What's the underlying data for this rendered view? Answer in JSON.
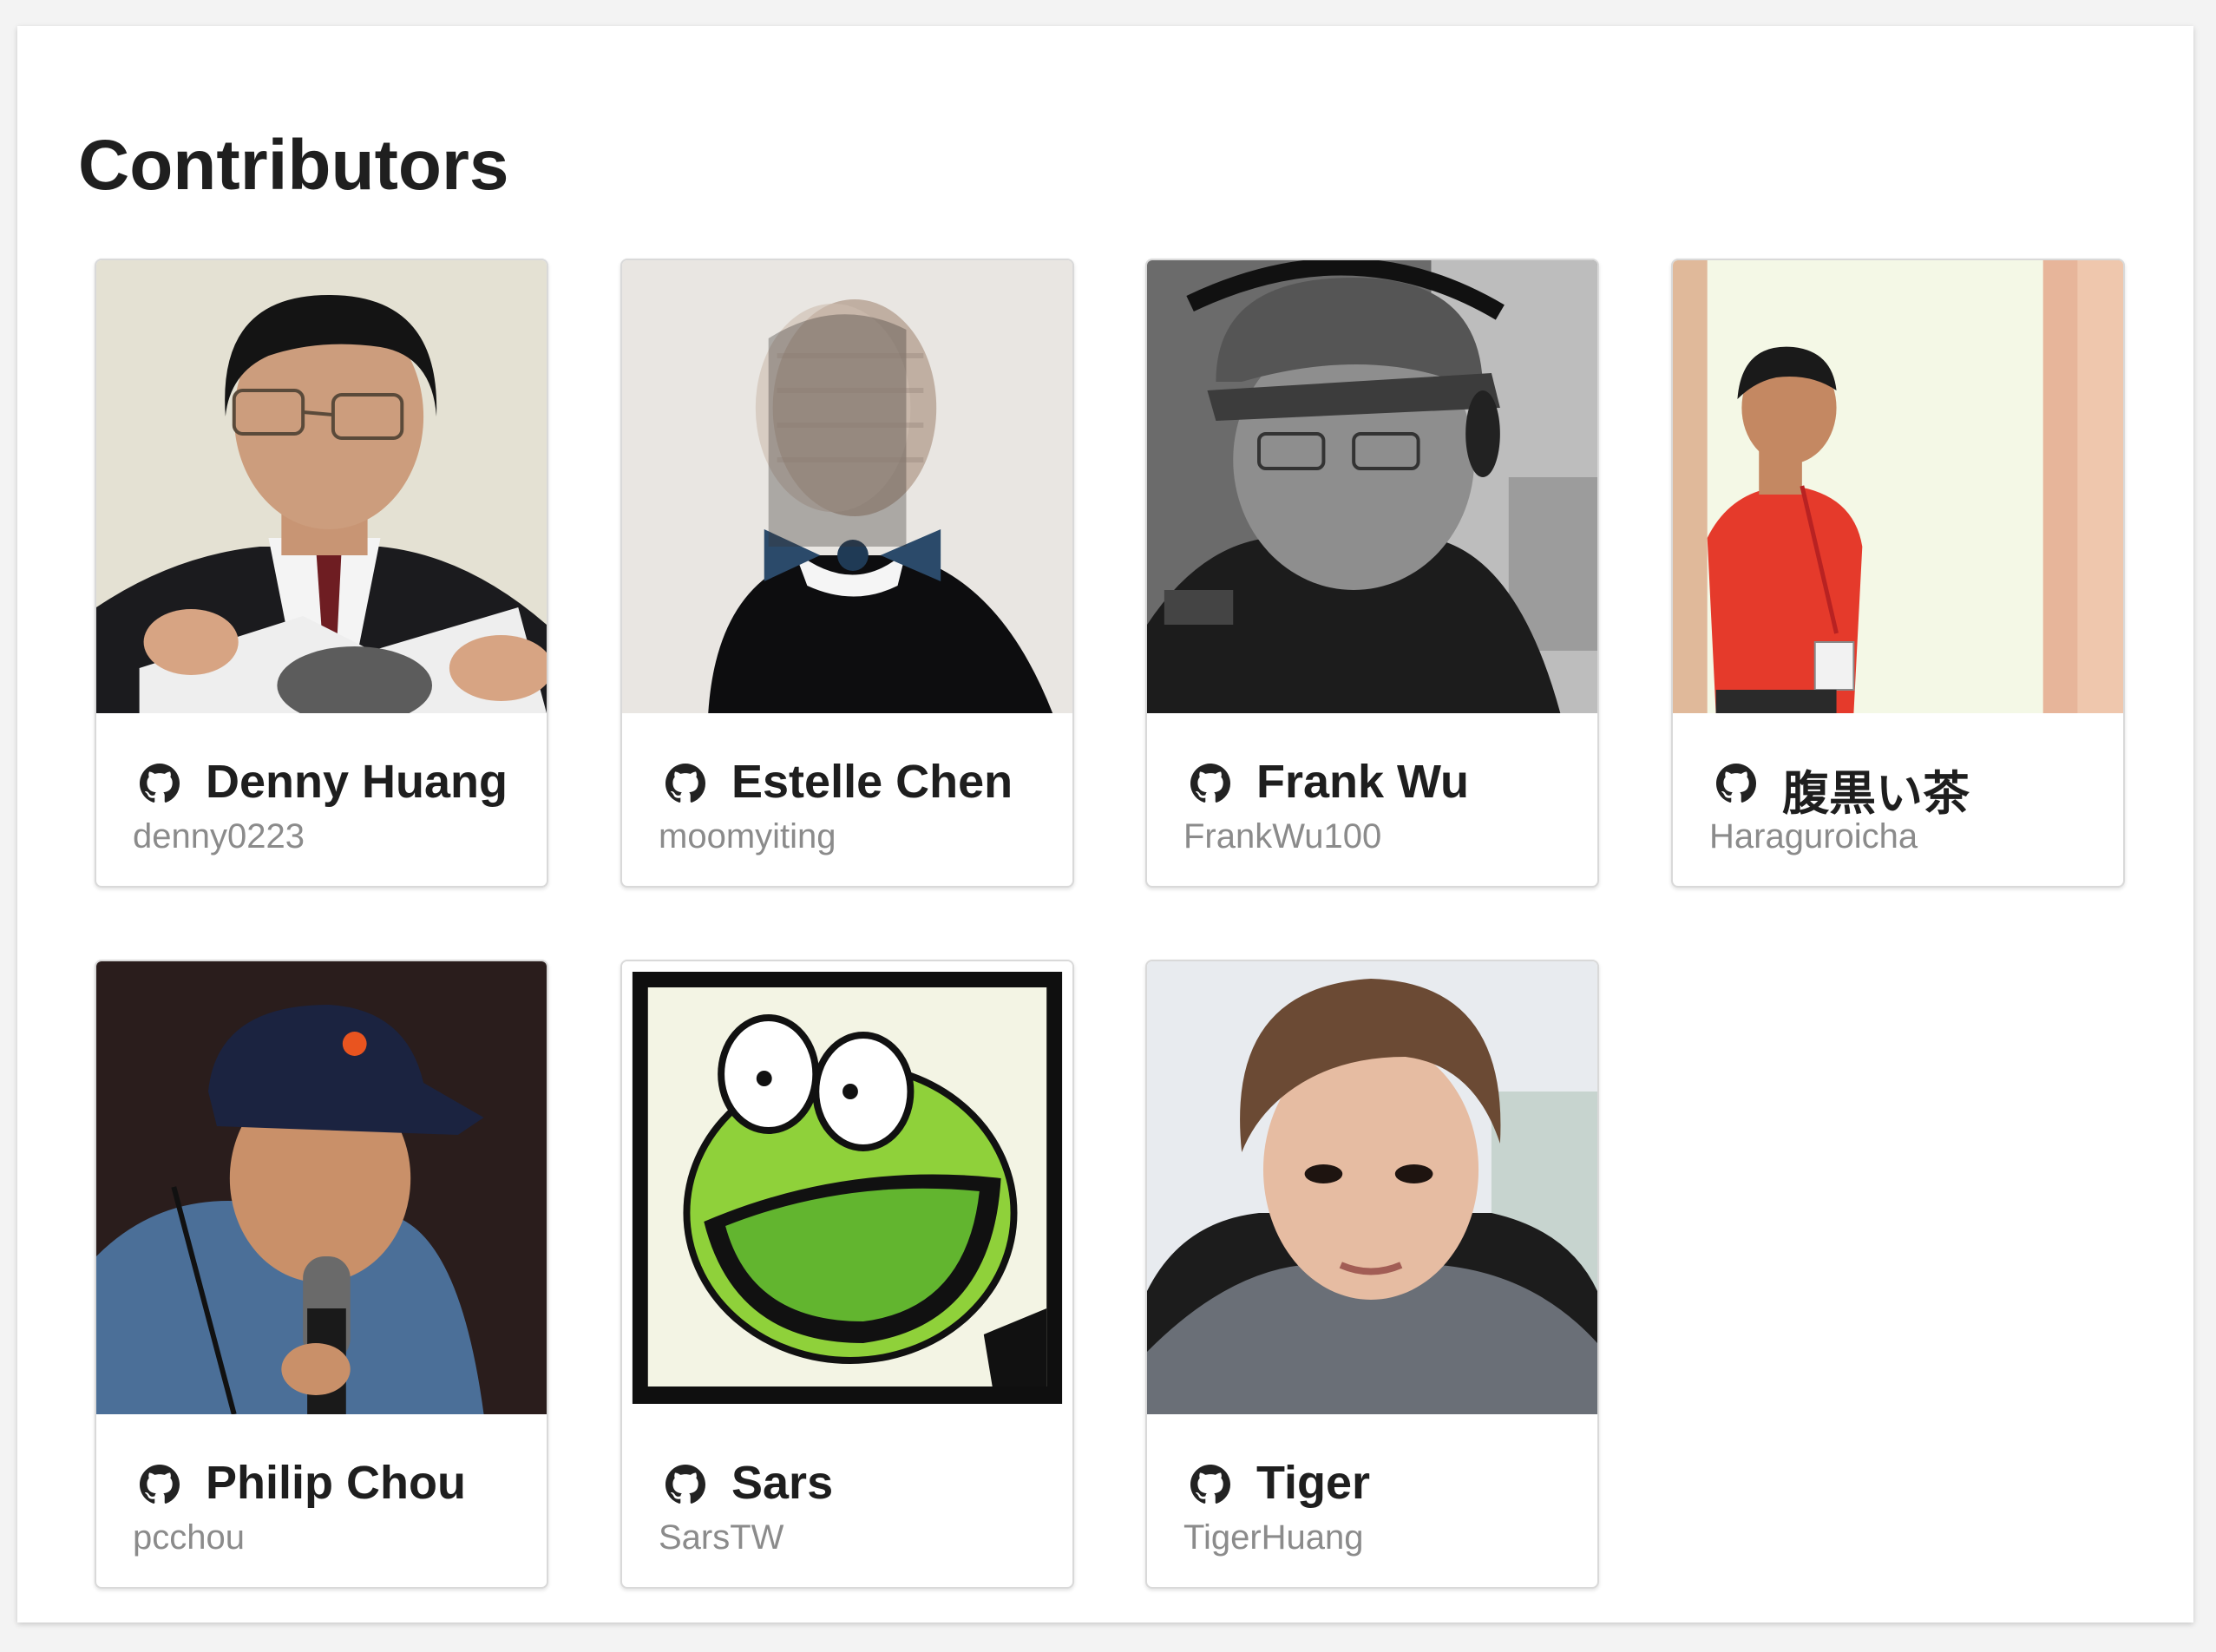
{
  "page": {
    "title": "Contributors"
  },
  "contributors": [
    {
      "name": "Denny Huang",
      "username": "denny0223",
      "icon": "github-icon"
    },
    {
      "name": "Estelle Chen",
      "username": "moomyiting",
      "icon": "github-icon"
    },
    {
      "name": "Frank Wu",
      "username": "FrankWu100",
      "icon": "github-icon"
    },
    {
      "name": "腹黒い茶",
      "username": "Haraguroicha",
      "icon": "github-icon"
    },
    {
      "name": "Philip Chou",
      "username": "pcchou",
      "icon": "github-icon"
    },
    {
      "name": "Sars",
      "username": "SarsTW",
      "icon": "github-icon"
    },
    {
      "name": "Tiger",
      "username": "TigerHuang",
      "icon": "github-icon"
    }
  ]
}
